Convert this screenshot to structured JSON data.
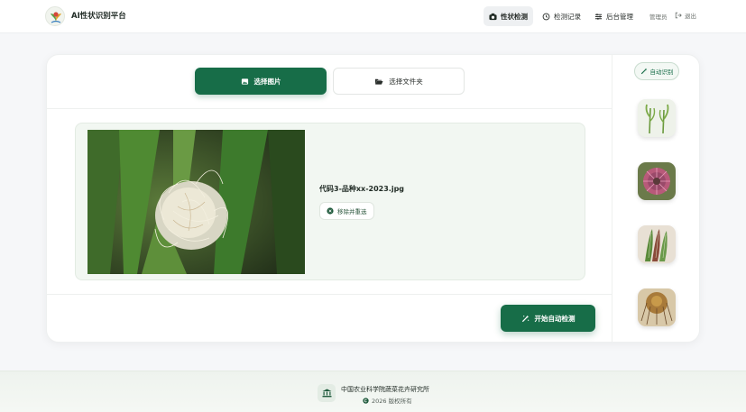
{
  "header": {
    "app_title": "AI性状识别平台",
    "nav": [
      {
        "label": "性状检测",
        "icon": "camera-icon",
        "active": true
      },
      {
        "label": "检测记录",
        "icon": "history-icon",
        "active": false
      },
      {
        "label": "后台管理",
        "icon": "sliders-icon",
        "active": false
      }
    ],
    "user": "管理员",
    "logout": "退出"
  },
  "upload": {
    "select_image": "选择图片",
    "select_folder": "选择文件夹"
  },
  "preview": {
    "file_name": "代码3-品种xx-2023.jpg",
    "remove_label": "移除并重选"
  },
  "actions": {
    "start_label": "开始自动检测"
  },
  "sidebar": {
    "auto_label": "自动识别",
    "thumbnails": [
      "plant-seedling-thumb",
      "flower-thumb",
      "leaf-thumb",
      "tassel-thumb"
    ]
  },
  "footer": {
    "org": "中国农业科学院蔬菜花卉研究所",
    "copyright": "2026 版权所有"
  },
  "colors": {
    "primary": "#176d48",
    "panel_bg": "#f2f7f2"
  }
}
